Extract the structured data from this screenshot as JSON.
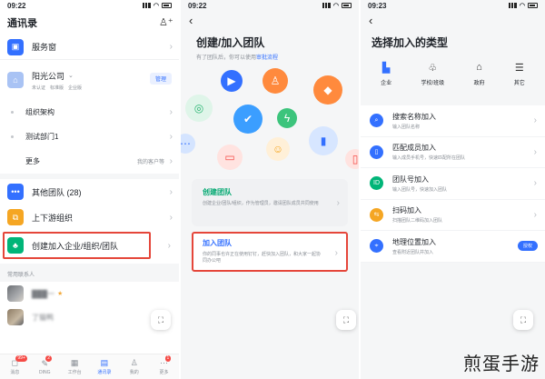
{
  "screen1": {
    "time": "09:22",
    "title": "通讯录",
    "service_label": "服务窗",
    "company": {
      "name": "阳光公司",
      "tags": [
        "未认证",
        "标准版",
        "企业版"
      ],
      "manage_label": "管理"
    },
    "sub_items": [
      {
        "label": "组织架构",
        "extra": ""
      },
      {
        "label": "测试部门1",
        "extra": ""
      },
      {
        "label": "更多",
        "extra": "我的客户等"
      }
    ],
    "team_items": [
      {
        "label": "其他团队 (28)"
      },
      {
        "label": "上下游组织"
      },
      {
        "label": "创建加入企业/组织/团队"
      }
    ],
    "frequent_label": "常用联系人",
    "contacts": [
      {
        "name": "███一"
      },
      {
        "name": "了猫鸭"
      }
    ],
    "tabs": [
      {
        "label": "消息",
        "badge": "99+"
      },
      {
        "label": "DING",
        "badge": "2"
      },
      {
        "label": "工作台",
        "badge": ""
      },
      {
        "label": "通讯录",
        "badge": ""
      },
      {
        "label": "我的",
        "badge": ""
      },
      {
        "label": "更多",
        "badge": "1"
      }
    ]
  },
  "screen2": {
    "time": "09:22",
    "title": "创建/加入团队",
    "subtitle_prefix": "有了团队后，你可以使用",
    "subtitle_link": "审批流程",
    "create_card": {
      "title": "创建团队",
      "desc": "创建企业/团队/组织，作为管理员，邀请团队成员共同使用"
    },
    "join_card": {
      "title": "加入团队",
      "desc": "你的同事也许正在使用钉钉，赶快加入团队，和大家一起协同办公吧"
    }
  },
  "screen3": {
    "time": "09:23",
    "title": "选择加入的类型",
    "categories": [
      {
        "label": "企业",
        "icon": "building-icon"
      },
      {
        "label": "学校/班级",
        "icon": "people-icon"
      },
      {
        "label": "政府",
        "icon": "government-icon"
      },
      {
        "label": "其它",
        "icon": "menu-icon"
      }
    ],
    "join_methods": [
      {
        "title": "搜索名称加入",
        "desc": "输入团队名称",
        "icon": "⌕",
        "color": "#3370ff"
      },
      {
        "title": "匹配成员加入",
        "desc": "输入成员手机号，快速匹配所在团队",
        "icon": "▯",
        "color": "#3370ff"
      },
      {
        "title": "团队号加入",
        "desc": "输入团队号，快速加入团队",
        "icon": "ID",
        "color": "#00b578"
      },
      {
        "title": "扫码加入",
        "desc": "扫描团队二维码加入团队",
        "icon": "⇆",
        "color": "#f5a623"
      },
      {
        "title": "地理位置加入",
        "desc": "查看附近团队并加入",
        "icon": "⌖",
        "color": "#3370ff",
        "action": "授权"
      }
    ]
  },
  "watermark": "煎蛋手游",
  "colors": {
    "accent": "#3370ff",
    "highlight_border": "#e5463a"
  }
}
